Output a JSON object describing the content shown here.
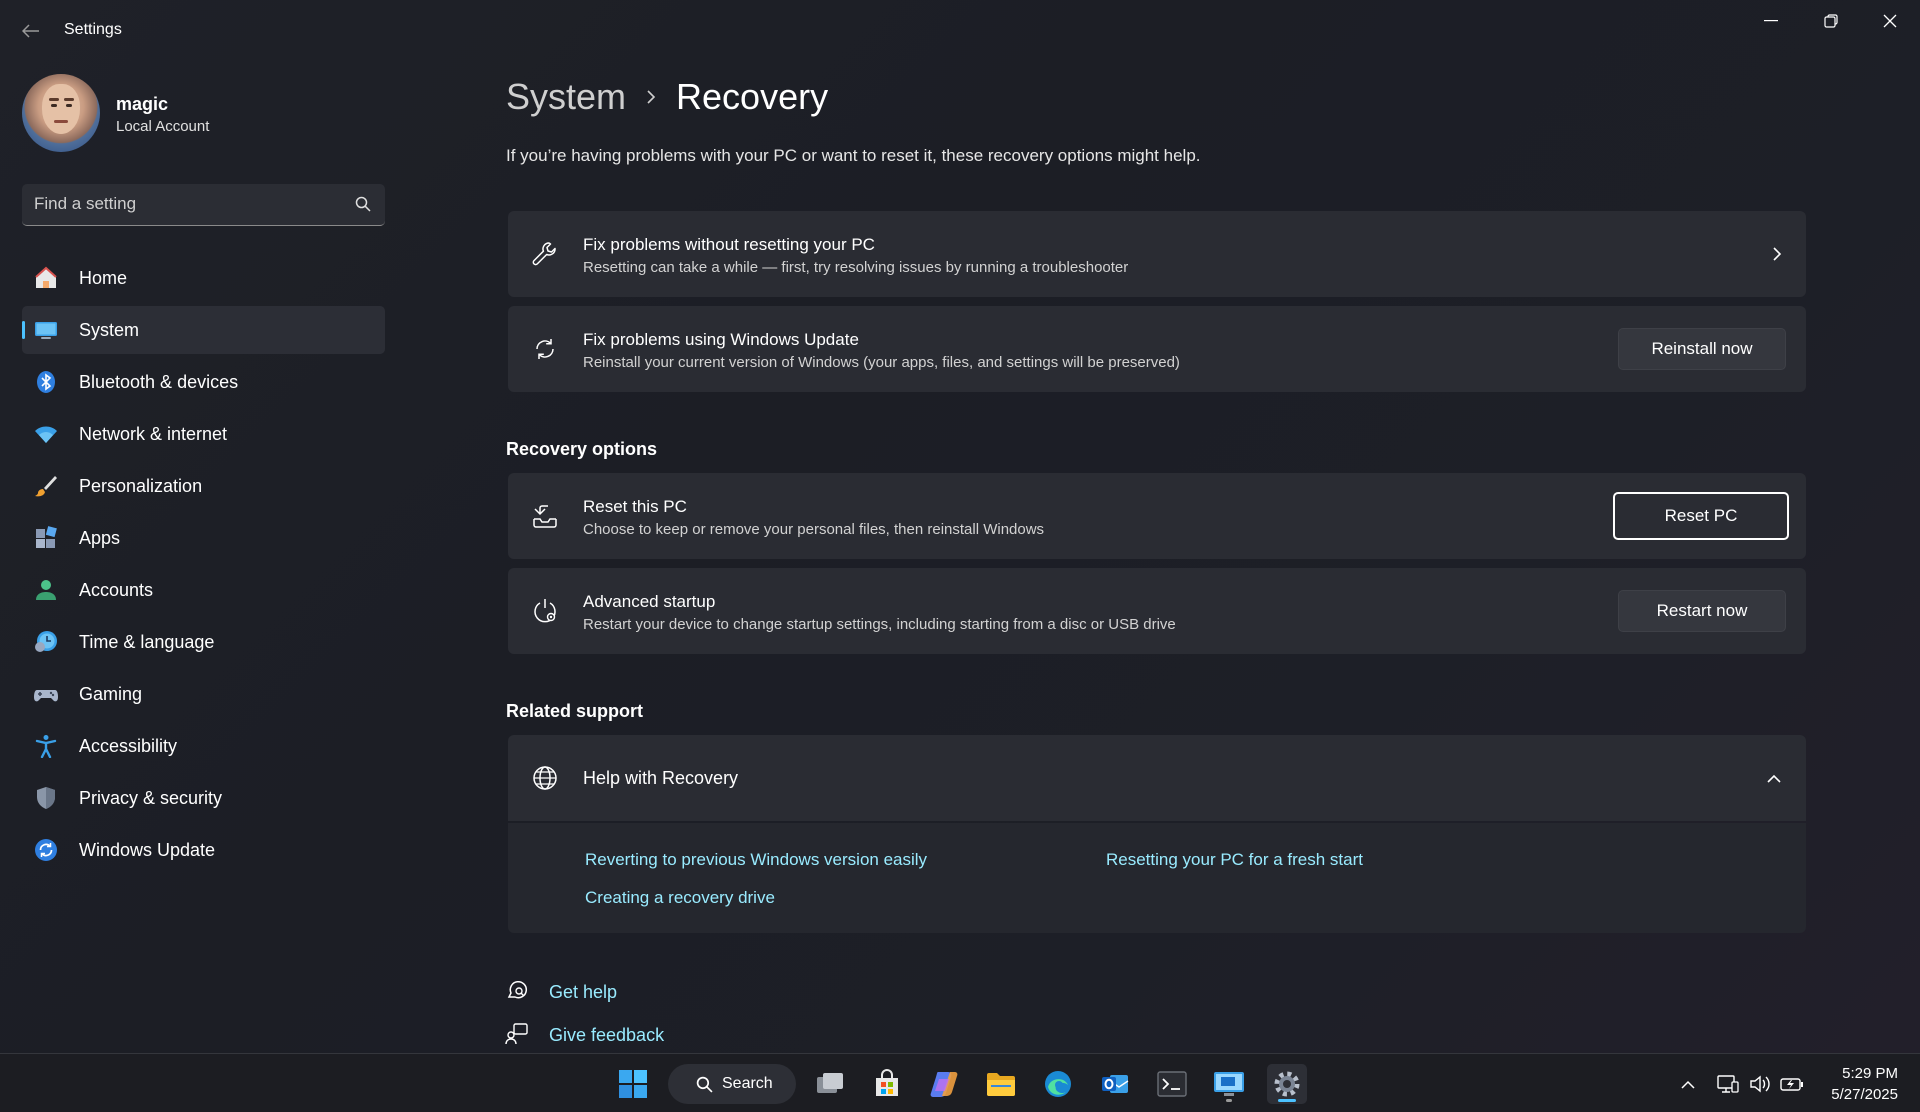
{
  "window": {
    "title": "Settings"
  },
  "profile": {
    "name": "magic",
    "account_type": "Local Account"
  },
  "search": {
    "placeholder": "Find a setting"
  },
  "nav": {
    "items": [
      {
        "label": "Home",
        "icon": "home-icon"
      },
      {
        "label": "System",
        "icon": "system-icon",
        "active": true
      },
      {
        "label": "Bluetooth & devices",
        "icon": "bluetooth-icon"
      },
      {
        "label": "Network & internet",
        "icon": "wifi-icon"
      },
      {
        "label": "Personalization",
        "icon": "brush-icon"
      },
      {
        "label": "Apps",
        "icon": "apps-icon"
      },
      {
        "label": "Accounts",
        "icon": "accounts-icon"
      },
      {
        "label": "Time & language",
        "icon": "time-language-icon"
      },
      {
        "label": "Gaming",
        "icon": "gamepad-icon"
      },
      {
        "label": "Accessibility",
        "icon": "accessibility-icon"
      },
      {
        "label": "Privacy & security",
        "icon": "shield-icon"
      },
      {
        "label": "Windows Update",
        "icon": "windows-update-icon"
      }
    ]
  },
  "breadcrumb": {
    "parent": "System",
    "current": "Recovery"
  },
  "intro": "If you’re having problems with your PC or want to reset it, these recovery options might help.",
  "cards": {
    "fix_without_reset": {
      "title": "Fix problems without resetting your PC",
      "description": "Resetting can take a while — first, try resolving issues by running a troubleshooter"
    },
    "windows_update": {
      "title": "Fix problems using Windows Update",
      "description": "Reinstall your current version of Windows (your apps, files, and settings will be preserved)",
      "button": "Reinstall now"
    }
  },
  "recovery_options": {
    "heading": "Recovery options",
    "reset_pc": {
      "title": "Reset this PC",
      "description": "Choose to keep or remove your personal files, then reinstall Windows",
      "button": "Reset PC"
    },
    "advanced_startup": {
      "title": "Advanced startup",
      "description": "Restart your device to change startup settings, including starting from a disc or USB drive",
      "button": "Restart now"
    }
  },
  "related_support": {
    "heading": "Related support",
    "help_title": "Help with Recovery",
    "links": [
      "Reverting to previous Windows version easily",
      "Resetting your PC for a fresh start",
      "Creating a recovery drive"
    ]
  },
  "footer": {
    "get_help": "Get help",
    "give_feedback": "Give feedback"
  },
  "taskbar": {
    "search_label": "Search",
    "time": "5:29 PM",
    "date": "5/27/2025"
  },
  "colors": {
    "accent": "#4cc2ff",
    "link": "#99ebff",
    "card_bg": "#2a2c33"
  }
}
